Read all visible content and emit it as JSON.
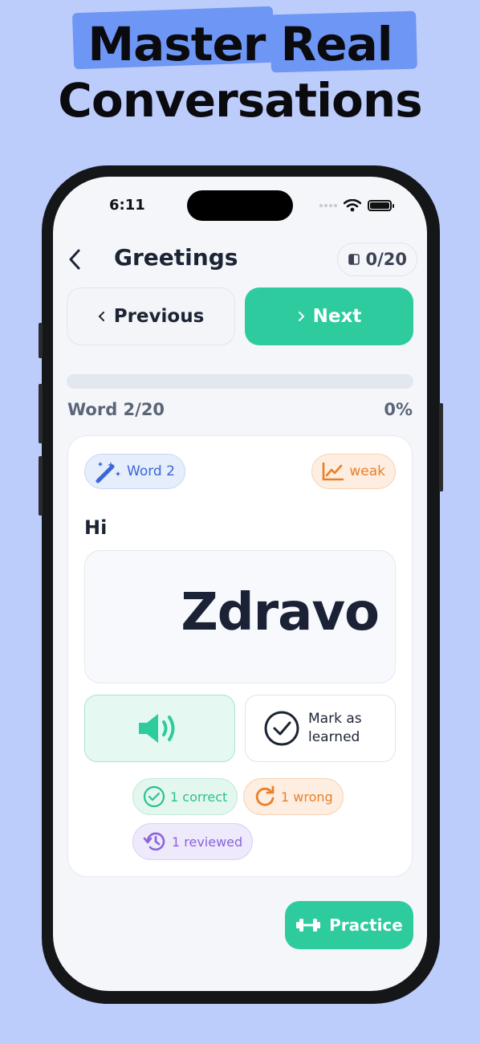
{
  "headline": {
    "line1_word1": "Master",
    "line1_word2": "Real",
    "line2": "Conversations"
  },
  "status_bar": {
    "time": "6:11"
  },
  "header": {
    "title": "Greetings",
    "progress_count": "0/20"
  },
  "nav": {
    "previous_label": "Previous",
    "next_label": "Next"
  },
  "progress": {
    "label": "Word 2/20",
    "percent_text": "0%",
    "fraction": 0
  },
  "card": {
    "word_chip": "Word 2",
    "strength_chip": "weak",
    "english": "Hi",
    "translation": "Zdravo",
    "mark_learned_label": "Mark as learned",
    "stats": {
      "correct": "1 correct",
      "wrong": "1 wrong",
      "reviewed": "1 reviewed"
    }
  },
  "practice_label": "Practice",
  "colors": {
    "accent": "#2dcb9e",
    "background": "#bccdfc",
    "weak": "#ea7f27",
    "word_chip": "#3a66d6",
    "reviewed": "#8a63dd"
  }
}
